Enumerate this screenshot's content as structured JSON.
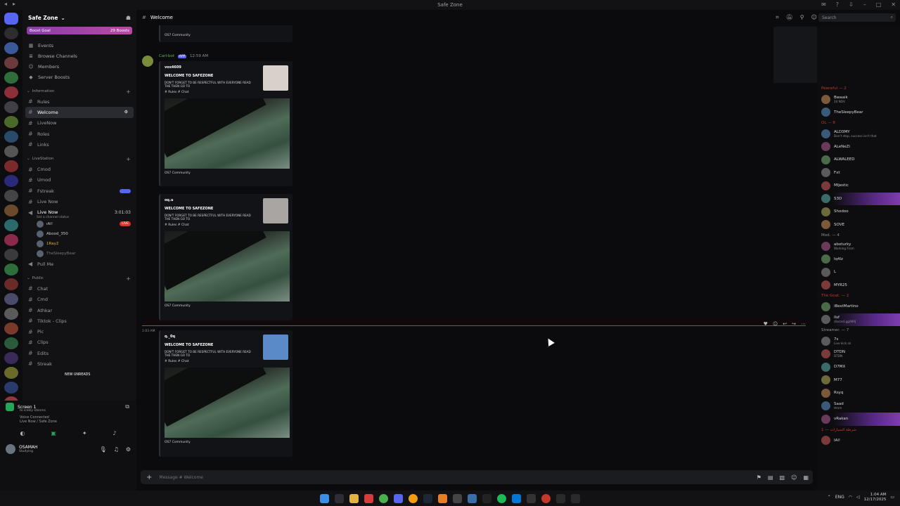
{
  "window": {
    "title": "Safe Zone"
  },
  "server": {
    "name": "Safe Zone",
    "boost_goal": "Boost Goal",
    "boost_count": "29 Boosts"
  },
  "nav": [
    {
      "icon": "calendar-icon",
      "label": "Events"
    },
    {
      "icon": "browse-icon",
      "label": "Browse Channels"
    },
    {
      "icon": "members-icon",
      "label": "Members"
    },
    {
      "icon": "boost-icon",
      "label": "Server Boosts"
    }
  ],
  "categories": {
    "information": {
      "label": "Information",
      "channels": [
        "Rules",
        "Welcome",
        "LiveNow",
        "Roles",
        "Links"
      ]
    },
    "livestation": {
      "label": "LiveStation",
      "channels": [
        "Cmod",
        "Umod",
        "Fstreak",
        "Live Now"
      ]
    },
    "live_now_voice": {
      "label": "Live Now",
      "status": "Set a channel status",
      "time": "3:01:03",
      "badge": "LIVE"
    },
    "voice_users": [
      "ıAl!",
      "Abood_350",
      "1Ray2",
      "TheSleepyBear"
    ],
    "pull_me": "Pull Me",
    "public": {
      "label": "Public",
      "channels": [
        "Chat",
        "Cmd",
        "Athkar",
        "Tiktok - Clips",
        "Pic",
        "Clips",
        "Edits",
        "Streak"
      ]
    },
    "new_unreads": "NEW UNREADS"
  },
  "voice_panel": {
    "screen": "Screen 1",
    "screen_sub": "to Icekly stenms",
    "connected": "Voice Connected",
    "channel": "Live Now / Safe Zone"
  },
  "user": {
    "name": "OSAMAH",
    "status": "Studying"
  },
  "channel_header": {
    "name": "Welcome"
  },
  "search": {
    "placeholder": "Search"
  },
  "messages": {
    "bot_name": "Carl-bot",
    "app_badge": "APP",
    "bot_time": "12:59 AM",
    "embed_title": "WELCOME TO SAFEZONE",
    "embed_text": "DON'T FORGET TO BE RESPECTFUL WITH EVERYONE READ THE THEN GO TO",
    "embed_links": "# Rules # Chat",
    "footer": "OS7 Community",
    "users": [
      "vox4609",
      "oq.u",
      "q._0q"
    ],
    "divider_time": "1:03 AM"
  },
  "composer": {
    "placeholder": "Message # Welcome"
  },
  "members": {
    "groups": [
      {
        "label": "Peaceful — 2",
        "red": true,
        "items": [
          {
            "name": "Bwaaik",
            "sub": "24 NOV"
          },
          {
            "name": "TheSleepyBear",
            "sub": ""
          }
        ]
      },
      {
        "label": "OL — 8",
        "red": true,
        "items": [
          {
            "name": "ALD3MY",
            "sub": "Don't stop, success isn't that"
          },
          {
            "name": "ALeNeZi",
            "sub": ""
          },
          {
            "name": "ALWALEED",
            "sub": ""
          },
          {
            "name": "Fxt",
            "sub": ""
          },
          {
            "name": "Mljestic",
            "sub": ""
          },
          {
            "name": "S3D",
            "sub": "",
            "hl": true
          },
          {
            "name": "Shodoo",
            "sub": ""
          },
          {
            "name": "SOVE",
            "sub": ""
          }
        ]
      },
      {
        "label": "Mod. — 4",
        "red": false,
        "items": [
          {
            "name": "aboturky",
            "sub": "Working From"
          },
          {
            "name": "lq4lz",
            "sub": ""
          },
          {
            "name": "L",
            "sub": ""
          },
          {
            "name": "MYR25",
            "sub": ""
          }
        ]
      },
      {
        "label": "The Goat. — 2",
        "red": true,
        "items": [
          {
            "name": "iBestMartino",
            "sub": ""
          },
          {
            "name": "Ilsf",
            "sub": "discord.gg/WAJ",
            "hl": true
          }
        ]
      },
      {
        "label": "Streamer. — 7",
        "red": false,
        "items": [
          {
            "name": "7s",
            "sub": "Live kick sk"
          },
          {
            "name": "DTDN",
            "sub": "DTDN"
          },
          {
            "name": "D7MX",
            "sub": ""
          },
          {
            "name": "M77",
            "sub": ""
          },
          {
            "name": "Rsyq",
            "sub": ""
          },
          {
            "name": "Saad",
            "sub": "Hmm"
          },
          {
            "name": "vRakan",
            "sub": "",
            "hl": true
          }
        ]
      },
      {
        "label": "شرطة السيارات — 1",
        "red": true,
        "items": [
          {
            "name": "IAl!",
            "sub": ""
          }
        ]
      }
    ]
  },
  "tray": {
    "lang": "ENG",
    "time": "1:04 AM",
    "date": "12/17/2025"
  }
}
